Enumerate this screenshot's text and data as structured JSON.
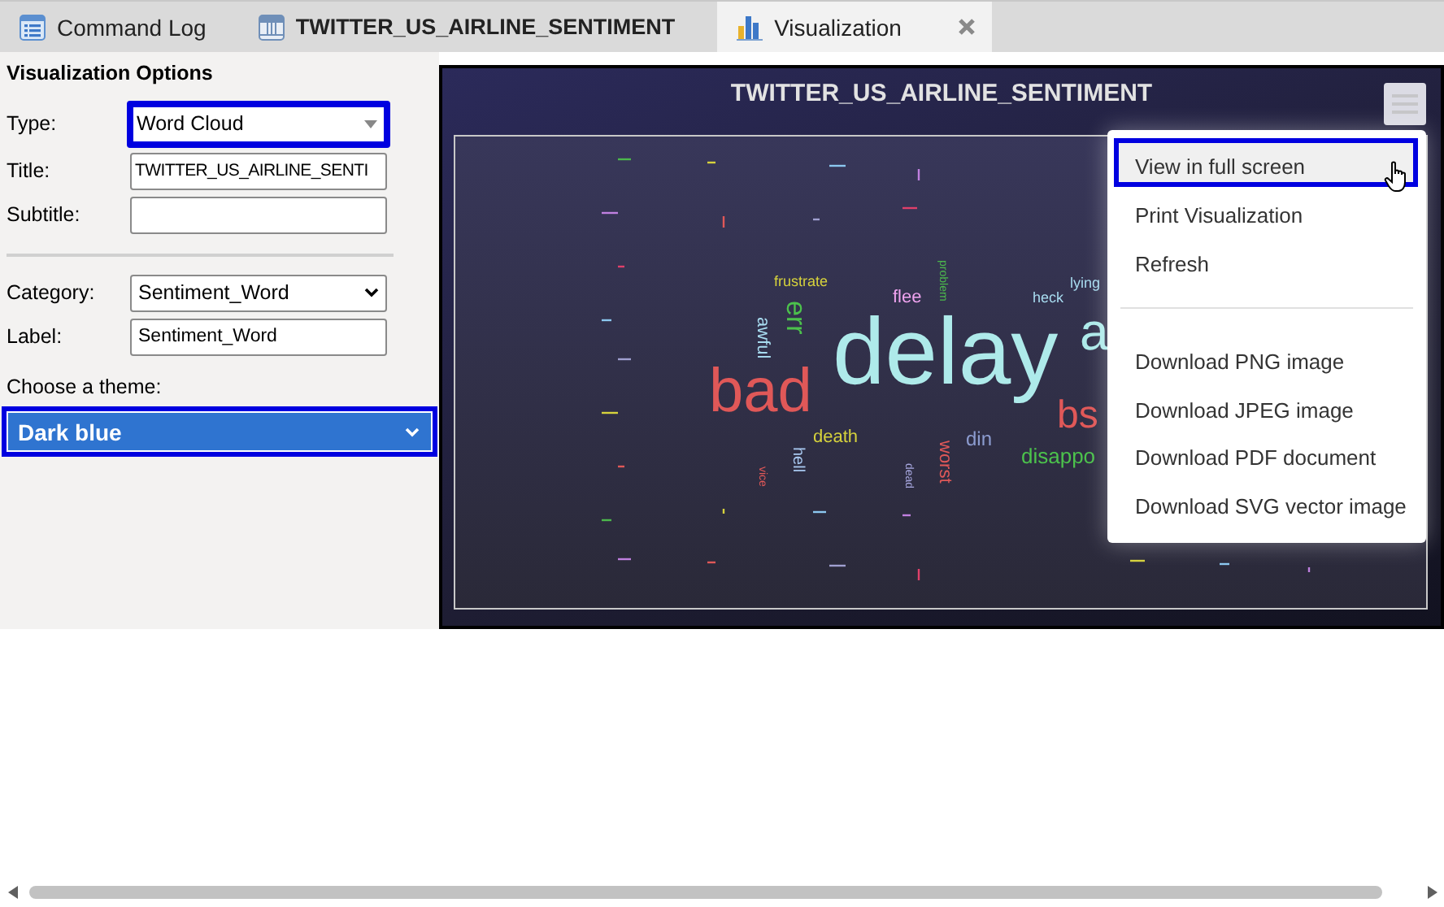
{
  "tabs": [
    {
      "label": "Command Log",
      "kind": "log",
      "selected": false,
      "closable": false
    },
    {
      "label": "TWITTER_US_AIRLINE_SENTIMENT",
      "kind": "table",
      "selected": false,
      "closable": false
    },
    {
      "label": "Visualization",
      "kind": "chart",
      "selected": true,
      "closable": true
    }
  ],
  "options": {
    "heading": "Visualization Options",
    "type": {
      "label": "Type:",
      "value": "Word Cloud",
      "focused": true
    },
    "title": {
      "label": "Title:",
      "value": "TWITTER_US_AIRLINE_SENTI"
    },
    "subtitle": {
      "label": "Subtitle:"
    },
    "category": {
      "label": "Category:",
      "value": "Sentiment_Word"
    },
    "label": {
      "label": "Label:",
      "value": "Sentiment_Word"
    },
    "theme": {
      "label": "Choose a theme:",
      "value": "Dark blue",
      "focused": true
    }
  },
  "chart": {
    "title": "TWITTER_US_AIRLINE_SENTIMENT",
    "words": [
      {
        "text": "frustrate",
        "color": "#d6d23c",
        "kind": "horizontal"
      },
      {
        "text": "err",
        "color": "#4cc24c",
        "kind": "vertical"
      },
      {
        "text": "awful",
        "color": "#a8dcf0",
        "kind": "vertical"
      },
      {
        "text": "flee",
        "color": "#f0a4f0",
        "kind": "horizontal"
      },
      {
        "text": "problem",
        "color": "#4cb84c",
        "kind": "vertical"
      },
      {
        "text": "heck",
        "color": "#a8dcf0",
        "kind": "horizontal"
      },
      {
        "text": "lying",
        "color": "#a8dcf0",
        "kind": "horizontal"
      },
      {
        "text": "delay",
        "color": "#aeeaea",
        "kind": "horizontal"
      },
      {
        "text": "a",
        "color": "#aeeaea",
        "kind": "horizontal"
      },
      {
        "text": "bad",
        "color": "#e05858",
        "kind": "horizontal"
      },
      {
        "text": "bs",
        "color": "#e05858",
        "kind": "horizontal"
      },
      {
        "text": "death",
        "color": "#d6d23c",
        "kind": "horizontal"
      },
      {
        "text": "din",
        "color": "#8c9cd0",
        "kind": "horizontal"
      },
      {
        "text": "disappo",
        "color": "#4cc24c",
        "kind": "horizontal"
      },
      {
        "text": "hell",
        "color": "#a8c8f0",
        "kind": "vertical"
      },
      {
        "text": "vice",
        "color": "#e05858",
        "kind": "vertical"
      },
      {
        "text": "dead",
        "color": "#a8a8e0",
        "kind": "vertical"
      },
      {
        "text": "worst",
        "color": "#e05858",
        "kind": "vertical"
      }
    ],
    "menu": [
      {
        "label": "View in full screen",
        "selected": true,
        "kind": "item"
      },
      {
        "label": "Print Visualization",
        "selected": false,
        "kind": "item"
      },
      {
        "label": "Refresh",
        "selected": false,
        "kind": "item"
      },
      {
        "kind": "separator"
      },
      {
        "label": "Download PNG image",
        "selected": false,
        "kind": "item"
      },
      {
        "label": "Download JPEG image",
        "selected": false,
        "kind": "item"
      },
      {
        "label": "Download PDF document",
        "selected": false,
        "kind": "item"
      },
      {
        "label": "Download SVG vector image",
        "selected": false,
        "kind": "item"
      }
    ]
  }
}
